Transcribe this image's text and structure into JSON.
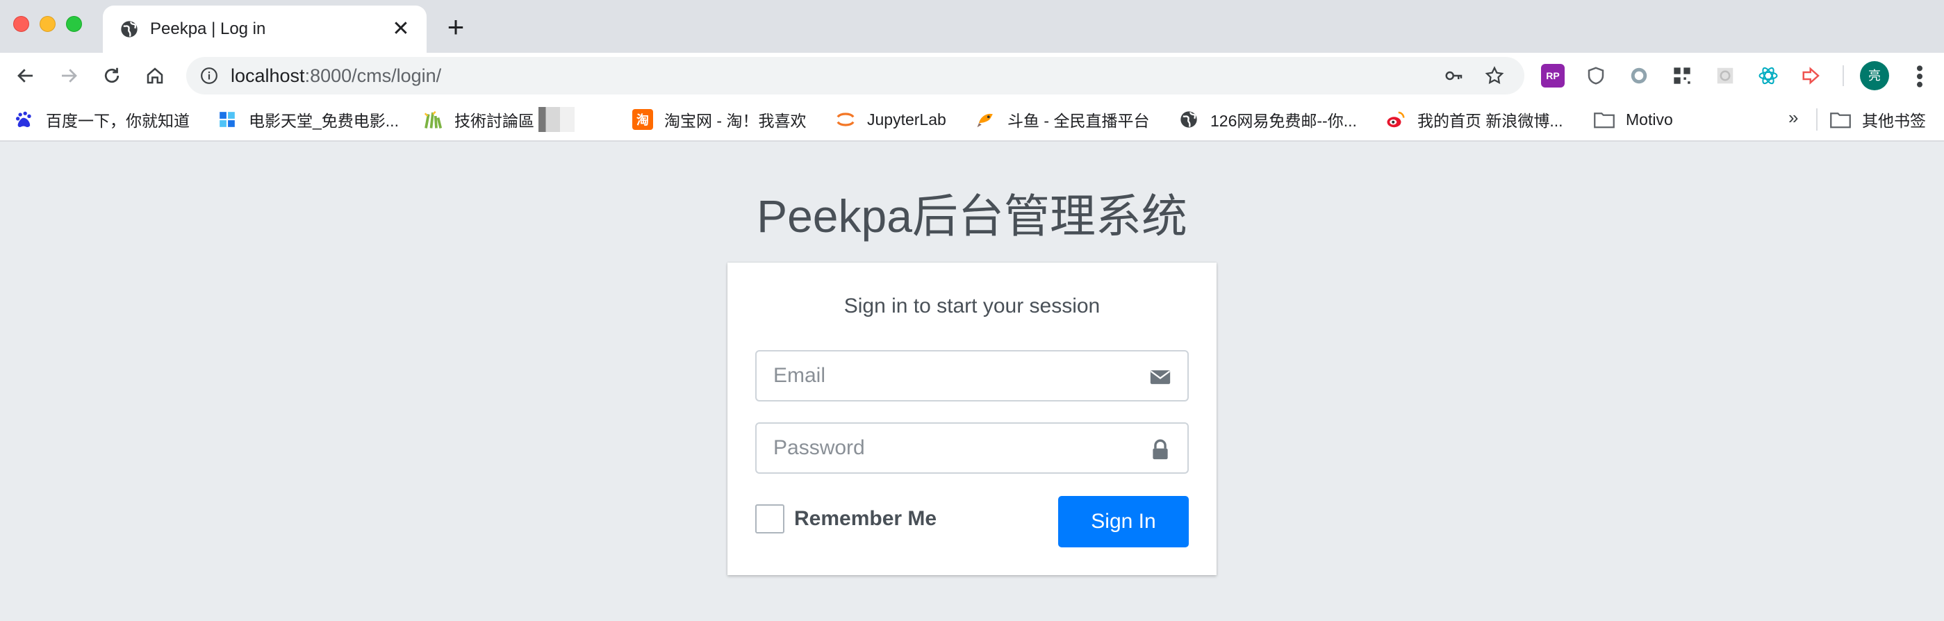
{
  "browser": {
    "tab": {
      "title": "Peekpa | Log in",
      "close_glyph": "✕"
    },
    "new_tab_glyph": "+",
    "url": {
      "host": "localhost",
      "path": ":8000/cms/login/"
    },
    "avatar_text": "亮",
    "bookmarks": [
      {
        "label": "百度一下，你就知道",
        "icon": "baidu-icon",
        "color": "#2932e1"
      },
      {
        "label": "电影天堂_免费电影...",
        "icon": "dytt-icon",
        "color": "#1a73e8"
      },
      {
        "label": "技術討論區",
        "icon": "plant-icon",
        "color": "#7cb342"
      },
      {
        "label": "淘宝网 - 淘！我喜欢",
        "icon": "taobao-icon",
        "color": "#ff6a00"
      },
      {
        "label": "JupyterLab",
        "icon": "jupyter-icon",
        "color": "#f37726"
      },
      {
        "label": "斗鱼 - 全民直播平台",
        "icon": "douyu-icon",
        "color": "#ff7700"
      },
      {
        "label": "126网易免费邮--你...",
        "icon": "globe-icon",
        "color": "#3c4043"
      },
      {
        "label": "我的首页 新浪微博...",
        "icon": "weibo-icon",
        "color": "#e6162d"
      },
      {
        "label": "Motivo",
        "icon": "folder-icon",
        "color": "#5f6368"
      }
    ],
    "bookmarks_more": "»",
    "other_bookmarks": "其他书签"
  },
  "page": {
    "logo_text": "Peekpa后台管理系统",
    "box_msg": "Sign in to start your session",
    "email_placeholder": "Email",
    "password_placeholder": "Password",
    "remember_label": "Remember Me",
    "signin_label": "Sign In",
    "accent_color": "#007bff"
  }
}
